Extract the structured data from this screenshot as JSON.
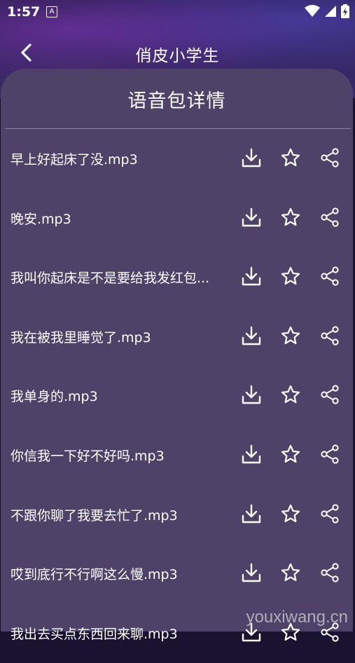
{
  "status_bar": {
    "time": "1:57",
    "notification_glyph": "A"
  },
  "app_bar": {
    "title": "俏皮小学生"
  },
  "sheet": {
    "title": "语音包详情",
    "items": [
      {
        "name": "早上好起床了没.mp3"
      },
      {
        "name": "晚安.mp3"
      },
      {
        "name": "我叫你起床是不是要给我发红包..."
      },
      {
        "name": "我在被我里睡觉了.mp3"
      },
      {
        "name": "我单身的.mp3"
      },
      {
        "name": "你信我一下好不好吗.mp3"
      },
      {
        "name": "不跟你聊了我要去忙了.mp3"
      },
      {
        "name": "哎到底行不行啊这么慢.mp3"
      },
      {
        "name": "我出去买点东西回来聊.mp3"
      }
    ]
  },
  "watermark": "youxiwang.cn",
  "colors": {
    "sheet": "#4e4268",
    "text": "#ffffff"
  }
}
